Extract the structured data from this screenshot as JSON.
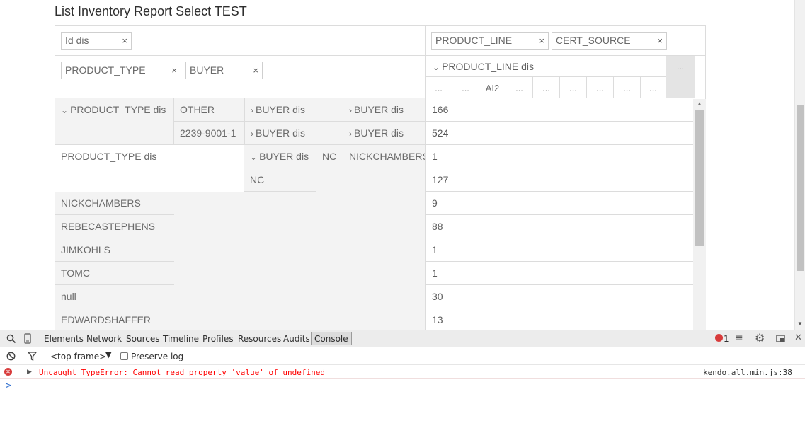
{
  "report": {
    "title": "List Inventory Report Select TEST"
  },
  "measures": {
    "chips": [
      {
        "label": "Id dis",
        "remove": "×"
      }
    ]
  },
  "columns": {
    "chips": [
      {
        "label": "PRODUCT_LINE",
        "remove": "×"
      },
      {
        "label": "CERT_SOURCE",
        "remove": "×"
      }
    ],
    "header": {
      "label": "PRODUCT_LINE dis",
      "more": "...",
      "cells": [
        "...",
        "...",
        "AI2",
        "...",
        "...",
        "...",
        "...",
        "...",
        "..."
      ]
    }
  },
  "rows": {
    "chips": [
      {
        "label": "PRODUCT_TYPE",
        "remove": "×"
      },
      {
        "label": "BUYER",
        "remove": "×"
      }
    ],
    "tree": {
      "group1": "PRODUCT_TYPE dis",
      "other": "OTHER",
      "code": "2239-9001-1",
      "buyer_dis": "BUYER dis",
      "group2": "PRODUCT_TYPE dis",
      "nc": "NC",
      "nickchambers": "NICKCHAMBERS",
      "names": [
        "NICKCHAMBERS",
        "REBECASTEPHENS",
        "JIMKOHLS",
        "TOMC",
        "null",
        "EDWARDSHAFFER"
      ]
    }
  },
  "data_values": [
    "166",
    "524",
    "1",
    "127",
    "9",
    "88",
    "1",
    "1",
    "30",
    "13"
  ],
  "devtools": {
    "tabs": [
      "Elements",
      "Network",
      "Sources",
      "Timeline",
      "Profiles",
      "Resources",
      "Audits",
      "Console"
    ],
    "active_tab": "Console",
    "error_count": "1",
    "frame": "<top frame>",
    "preserve_log": "Preserve log",
    "error": {
      "message": "Uncaught TypeError: Cannot read property 'value' of undefined",
      "source": "kendo.all.min.js:38"
    },
    "prompt": ">"
  },
  "colors": {
    "error": "#ff0000",
    "border": "#dcdcdc",
    "row_header_bg": "#f3f3f3"
  }
}
